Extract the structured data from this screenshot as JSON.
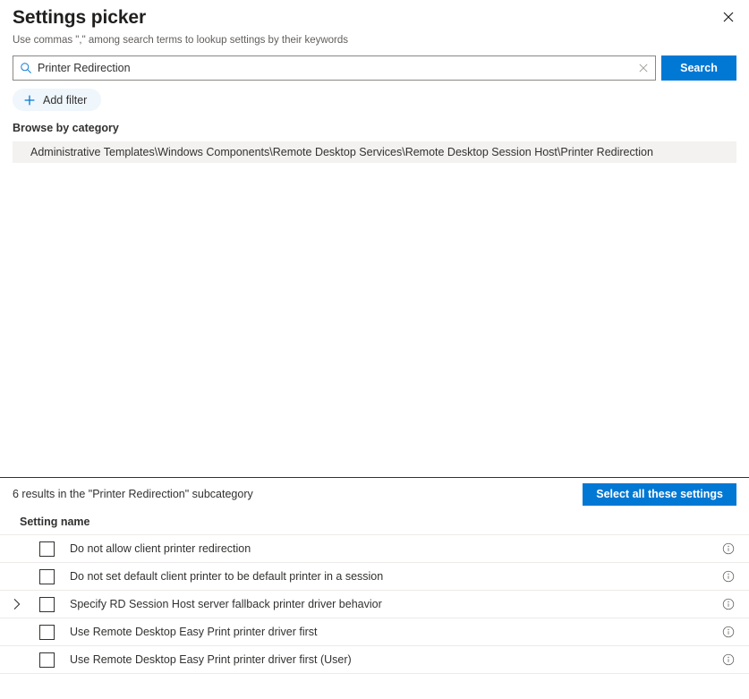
{
  "header": {
    "title": "Settings picker",
    "subtitle": "Use commas \",\" among search terms to lookup settings by their keywords",
    "close_label": "✕"
  },
  "search": {
    "value": "Printer Redirection",
    "placeholder": "Search",
    "clear_label": "✕",
    "button_label": "Search",
    "icon": "search-icon"
  },
  "filters": {
    "add_filter_label": "Add filter",
    "plus_label": "+"
  },
  "browse": {
    "label": "Browse by category",
    "category_path": "Administrative Templates\\Windows Components\\Remote Desktop Services\\Remote Desktop Session Host\\Printer Redirection"
  },
  "results": {
    "count_text": "6 results in the \"Printer Redirection\" subcategory",
    "select_all_label": "Select all these settings",
    "column_header": "Setting name",
    "rows": [
      {
        "label": "Do not allow client printer redirection",
        "expandable": false,
        "checked": false
      },
      {
        "label": "Do not set default client printer to be default printer in a session",
        "expandable": false,
        "checked": false
      },
      {
        "label": "Specify RD Session Host server fallback printer driver behavior",
        "expandable": true,
        "checked": false
      },
      {
        "label": "Use Remote Desktop Easy Print printer driver first",
        "expandable": false,
        "checked": false
      },
      {
        "label": "Use Remote Desktop Easy Print printer driver first (User)",
        "expandable": false,
        "checked": false
      }
    ]
  },
  "colors": {
    "accent": "#0078d4",
    "chip_bg": "#eff6fc",
    "category_bg": "#f3f2f1",
    "text": "#323130"
  }
}
